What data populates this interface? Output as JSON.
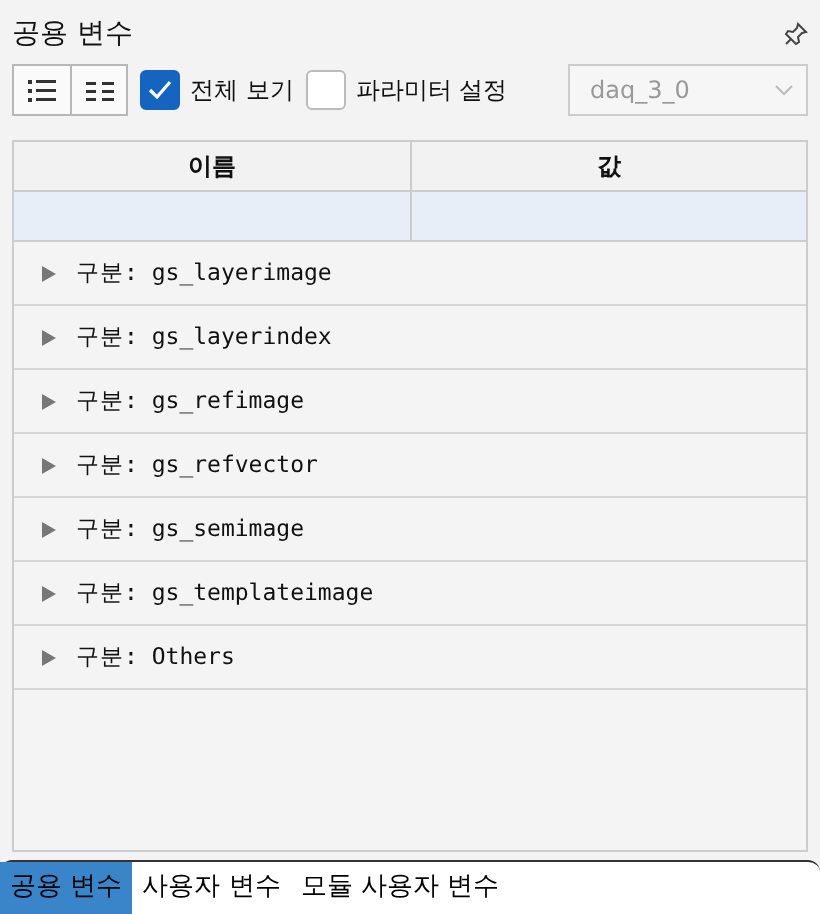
{
  "panel": {
    "title": "공용 변수"
  },
  "toolbar": {
    "view_buttons": [
      {
        "kind": "list"
      },
      {
        "kind": "grid"
      }
    ],
    "checkboxes": [
      {
        "label": "전체 보기",
        "checked": true
      },
      {
        "label": "파라미터 설정",
        "checked": false
      }
    ],
    "dropdown": {
      "value": "daq_3_0",
      "disabled": true
    }
  },
  "table": {
    "columns": [
      "이름",
      "값"
    ],
    "groups": [
      {
        "label": "구분: gs_layerimage",
        "expanded": false
      },
      {
        "label": "구분: gs_layerindex",
        "expanded": false
      },
      {
        "label": "구분: gs_refimage",
        "expanded": false
      },
      {
        "label": "구분: gs_refvector",
        "expanded": false
      },
      {
        "label": "구분: gs_semimage",
        "expanded": false
      },
      {
        "label": "구분: gs_templateimage",
        "expanded": false
      },
      {
        "label": "구분: Others",
        "expanded": false
      }
    ]
  },
  "tabs": [
    {
      "label": "공용 변수",
      "selected": true
    },
    {
      "label": "사용자 변수",
      "selected": false
    },
    {
      "label": "모듈 사용자 변수",
      "selected": false
    }
  ]
}
